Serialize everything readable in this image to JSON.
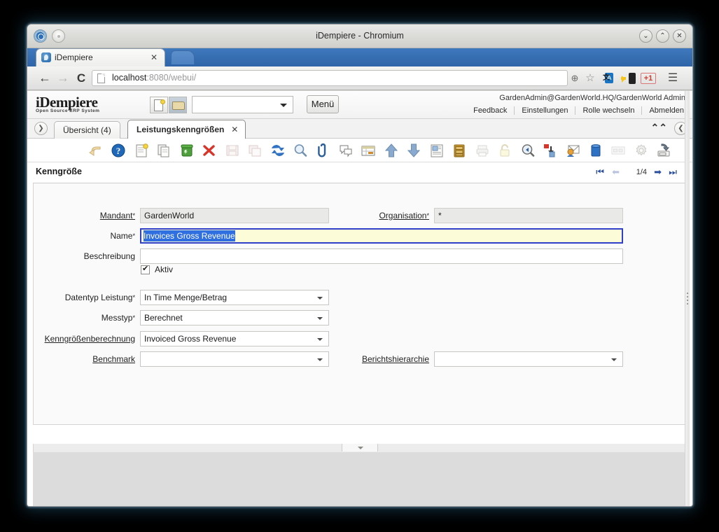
{
  "window": {
    "title": "iDempiere - Chromium",
    "minimize_label": "⌄",
    "maximize_label": "⌃",
    "close_label": "✕"
  },
  "browser": {
    "tab_title": "iDempiere",
    "tab_close": "✕",
    "back_label": "←",
    "forward_label": "→",
    "reload_label": "C",
    "url_host": "localhost",
    "url_path": ":8080/webui/",
    "zoom_icon": "⊕",
    "star_icon": "☆",
    "translate_icon": "A",
    "plusone_icon": "+1",
    "menu_icon": "☰"
  },
  "app_header": {
    "logo_line1": "iDempiere",
    "logo_line2": "Open Source  ERP System",
    "search_value": "",
    "menu_button": "Menü",
    "user_info": "GardenAdmin@GardenWorld.HQ/GardenWorld Admin",
    "links": [
      "Feedback",
      "Einstellungen",
      "Rolle wechseln",
      "Abmelden"
    ]
  },
  "window_tabs": {
    "collapse_left_icon": "❯",
    "collapse_right_icon": "❮",
    "collapse_up_icon": "⌃⌃",
    "items": [
      {
        "label": "Übersicht (4)",
        "active": false
      },
      {
        "label": "Leistungskenngrößen",
        "active": true,
        "closable": true
      }
    ]
  },
  "toolbar": {
    "icons": [
      "undo-icon",
      "help-icon",
      "new-record-icon",
      "copy-record-icon",
      "delete-icon",
      "delete-selection-icon",
      "save-icon",
      "save-create-icon",
      "refresh-icon",
      "find-icon",
      "attachment-icon",
      "chat-icon",
      "grid-toggle-icon",
      "parent-record-icon",
      "detail-record-icon",
      "report-icon",
      "archive-icon",
      "print-icon",
      "lock-icon",
      "zoom-across-icon",
      "process-icon",
      "request-icon",
      "product-info-icon",
      "export-icon",
      "preference-icon",
      "archive-document-icon",
      "exit-icon"
    ]
  },
  "form": {
    "title": "Kenngröße",
    "nav": {
      "first_icon": "⏮",
      "prev_icon": "⬅",
      "counter": "1/4",
      "next_icon": "➡",
      "last_icon": "⏭"
    },
    "fields": {
      "mandant": {
        "label": "Mandant",
        "required": "*",
        "value": "GardenWorld"
      },
      "organisation": {
        "label": "Organisation",
        "required": "*",
        "value": "*"
      },
      "name": {
        "label": "Name",
        "required": "*",
        "value": "Invoices Gross Revenue"
      },
      "beschreibung": {
        "label": "Beschreibung",
        "required": "",
        "value": ""
      },
      "aktiv": {
        "label": "Aktiv",
        "checked": true
      },
      "datentyp_leistung": {
        "label": "Datentyp Leistung",
        "required": "*",
        "value": "In Time Menge/Betrag"
      },
      "messtyp": {
        "label": "Messtyp",
        "required": "*",
        "value": "Berechnet"
      },
      "kenngroessenberechnung": {
        "label": "Kenngrößenberechnung",
        "required": "",
        "value": "Invoiced Gross Revenue"
      },
      "benchmark": {
        "label": "Benchmark",
        "required": "",
        "value": ""
      },
      "berichtshierarchie": {
        "label": "Berichtshierarchie",
        "required": "",
        "value": ""
      }
    }
  },
  "colors": {
    "accent": "#2b4f9e",
    "focus_border": "#2f3fc9",
    "focus_bg": "#fdfcd9",
    "selection": "#2f6fe0"
  }
}
